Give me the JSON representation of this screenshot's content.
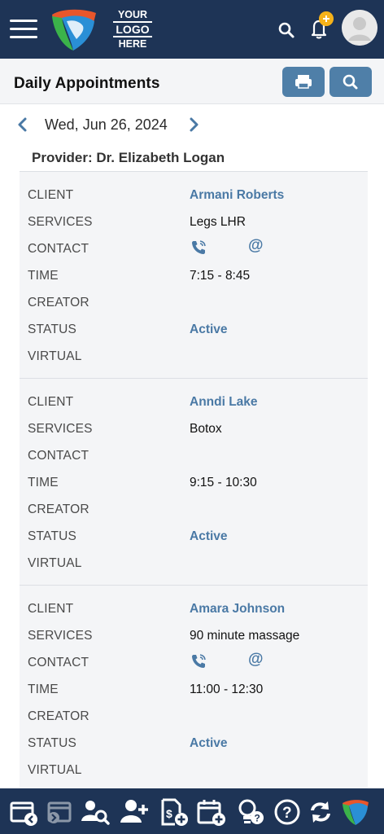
{
  "header": {
    "logo_text": [
      "YOUR",
      "LOGO",
      "HERE"
    ],
    "icons": [
      "menu-icon",
      "app-logo-icon",
      "search-icon",
      "bell-icon",
      "avatar"
    ]
  },
  "titlebar": {
    "title": "Daily Appointments",
    "buttons": [
      "print-icon",
      "search-icon"
    ]
  },
  "date_nav": {
    "date": "Wed, Jun 26, 2024"
  },
  "provider": "Provider: Dr. Elizabeth Logan",
  "labels": {
    "client": "CLIENT",
    "services": "SERVICES",
    "contact": "CONTACT",
    "time": "TIME",
    "creator": "CREATOR",
    "status": "STATUS",
    "virtual": "VIRTUAL"
  },
  "appointments": [
    {
      "client": "Armani Roberts",
      "services": "Legs LHR",
      "contact_icons": true,
      "time": "7:15 - 8:45",
      "creator": "",
      "status": "Active",
      "virtual": ""
    },
    {
      "client": "Anndi Lake",
      "services": "Botox",
      "contact_icons": false,
      "time": "9:15 - 10:30",
      "creator": "",
      "status": "Active",
      "virtual": ""
    },
    {
      "client": "Amara Johnson",
      "services": "90 minute massage",
      "contact_icons": true,
      "time": "11:00 - 12:30",
      "creator": "",
      "status": "Active",
      "virtual": ""
    }
  ],
  "colors": {
    "navy": "#1e3456",
    "accent": "#4f7fa8",
    "link": "#4a79a5",
    "badge": "#f5b21a"
  },
  "bottom_nav": [
    "check-out-icon",
    "check-in-icon",
    "client-search-icon",
    "add-client-icon",
    "add-invoice-icon",
    "add-appointment-icon",
    "ideas-icon",
    "help-icon",
    "sync-icon",
    "app-logo-icon"
  ]
}
